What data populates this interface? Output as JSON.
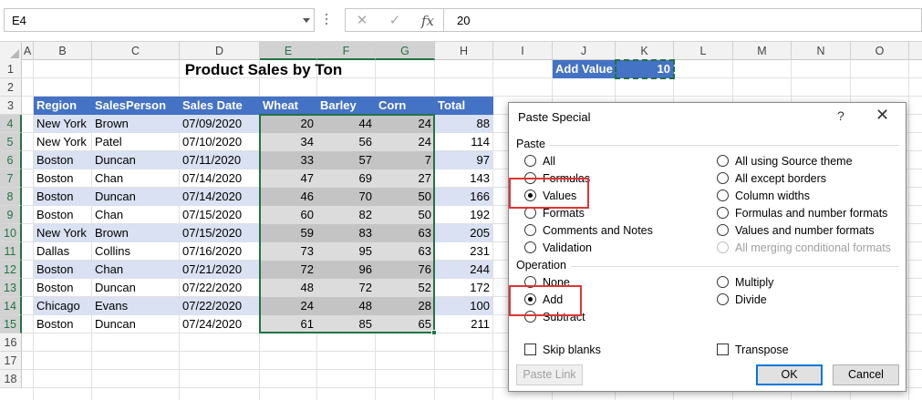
{
  "formula_bar": {
    "name_box": "E4",
    "cancel_icon": "✕",
    "enter_icon": "✓",
    "function_icon": "fx",
    "value": "20"
  },
  "columns": [
    "A",
    "B",
    "C",
    "D",
    "E",
    "F",
    "G",
    "H",
    "I",
    "J",
    "K",
    "L",
    "M",
    "N",
    "O"
  ],
  "selected_columns": [
    "E",
    "F",
    "G"
  ],
  "rows": [
    "1",
    "2",
    "3",
    "4",
    "5",
    "6",
    "7",
    "8",
    "9",
    "10",
    "11",
    "12",
    "13",
    "14",
    "15",
    "16",
    "17",
    "18"
  ],
  "selected_rows": [
    "4",
    "5",
    "6",
    "7",
    "8",
    "9",
    "10",
    "11",
    "12",
    "13",
    "14",
    "15"
  ],
  "sheet": {
    "title": "Product Sales by Ton",
    "add_value_label": "Add Value",
    "add_value": "10",
    "headers": [
      "Region",
      "SalesPerson",
      "Sales Date",
      "Wheat",
      "Barley",
      "Corn",
      "Total"
    ],
    "data": [
      [
        "New York",
        "Brown",
        "07/09/2020",
        "20",
        "44",
        "24",
        "88"
      ],
      [
        "New York",
        "Patel",
        "07/10/2020",
        "34",
        "56",
        "24",
        "114"
      ],
      [
        "Boston",
        "Duncan",
        "07/11/2020",
        "33",
        "57",
        "7",
        "97"
      ],
      [
        "Boston",
        "Chan",
        "07/14/2020",
        "47",
        "69",
        "27",
        "143"
      ],
      [
        "Boston",
        "Duncan",
        "07/14/2020",
        "46",
        "70",
        "50",
        "166"
      ],
      [
        "Boston",
        "Chan",
        "07/15/2020",
        "60",
        "82",
        "50",
        "192"
      ],
      [
        "New York",
        "Brown",
        "07/15/2020",
        "59",
        "83",
        "63",
        "205"
      ],
      [
        "Dallas",
        "Collins",
        "07/16/2020",
        "73",
        "95",
        "63",
        "231"
      ],
      [
        "Boston",
        "Chan",
        "07/21/2020",
        "72",
        "96",
        "76",
        "244"
      ],
      [
        "Boston",
        "Duncan",
        "07/22/2020",
        "48",
        "72",
        "52",
        "172"
      ],
      [
        "Chicago",
        "Evans",
        "07/22/2020",
        "24",
        "48",
        "28",
        "100"
      ],
      [
        "Boston",
        "Duncan",
        "07/24/2020",
        "61",
        "85",
        "65",
        "211"
      ]
    ]
  },
  "dialog": {
    "title": "Paste Special",
    "help": "?",
    "close": "✕",
    "paste_group": "Paste",
    "paste_left": [
      "All",
      "Formulas",
      "Values",
      "Formats",
      "Comments and Notes",
      "Validation"
    ],
    "paste_right": [
      "All using Source theme",
      "All except borders",
      "Column widths",
      "Formulas and number formats",
      "Values and number formats",
      "All merging conditional formats"
    ],
    "paste_selected": "Values",
    "operation_group": "Operation",
    "op_left": [
      "None",
      "Add",
      "Subtract"
    ],
    "op_right": [
      "Multiply",
      "Divide"
    ],
    "op_selected": "Add",
    "skip_blanks": "Skip blanks",
    "transpose": "Transpose",
    "paste_link": "Paste Link",
    "ok": "OK",
    "cancel": "Cancel"
  },
  "colors": {
    "header_blue": "#4472c4",
    "band_blue": "#d9e1f2",
    "selection_green": "#217346",
    "highlight_red": "#e03434"
  }
}
